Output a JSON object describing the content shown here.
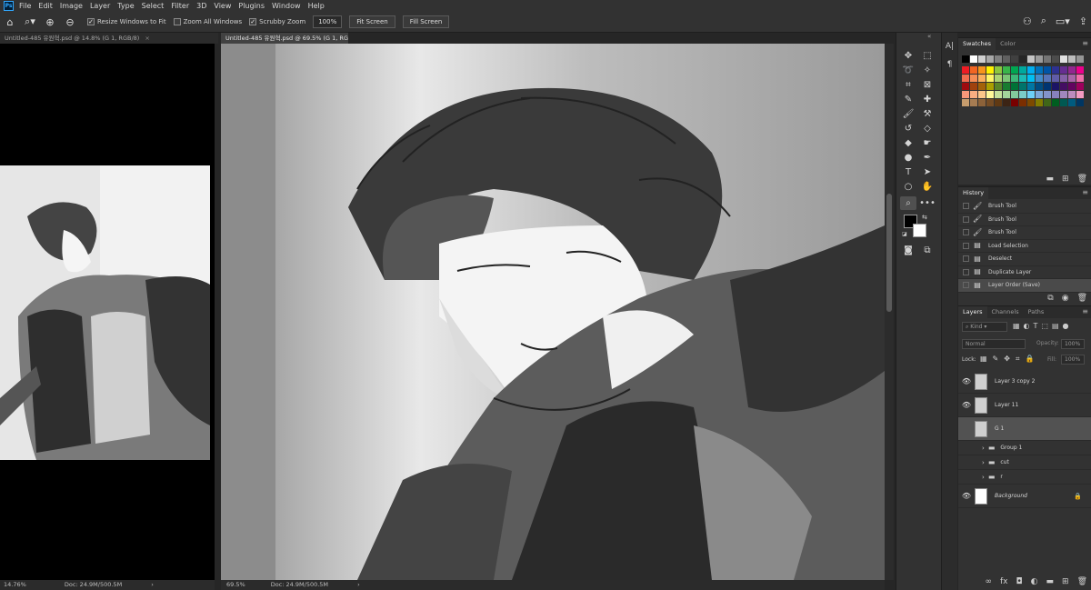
{
  "app": {
    "logo": "Ps"
  },
  "menu": [
    "File",
    "Edit",
    "Image",
    "Layer",
    "Type",
    "Select",
    "Filter",
    "3D",
    "View",
    "Plugins",
    "Window",
    "Help"
  ],
  "options": {
    "resize_windows_to_fit": "Resize Windows to Fit",
    "zoom_all_windows": "Zoom All Windows",
    "scrubby_zoom": "Scrubby Zoom",
    "zoom_value": "100%",
    "fit_screen": "Fit Screen",
    "fill_screen": "Fill Screen"
  },
  "tabs": [
    {
      "label": "Untitled-485 유원혁.psd @ 14.8% (G 1, RGB/8)",
      "close": "×"
    },
    {
      "label": "Untitled-485 유원혁.psd @ 69.5% (G 1, RGB/8)",
      "close": "×"
    }
  ],
  "status_left": {
    "zoom": "14.76%",
    "doc": "Doc: 24.9M/500.5M",
    "arrow": "›"
  },
  "status_main": {
    "zoom": "69.5%",
    "doc": "Doc: 24.9M/500.5M",
    "arrow": "›"
  },
  "swatches": {
    "tabs": [
      "Swatches",
      "Color"
    ],
    "colors": [
      [
        "#000000",
        "#ffffff",
        "#d0d0d0",
        "#a8a8a8",
        "#808080",
        "#606060",
        "#404040",
        "#262626",
        "#c4c4c4",
        "#9c9c9c",
        "#747474",
        "#4c4c4c",
        "#e0e0e0",
        "#bcbcbc",
        "#969696"
      ],
      [
        "#ed1c24",
        "#f26522",
        "#f7941d",
        "#fff200",
        "#8dc63f",
        "#39b54a",
        "#00a651",
        "#00a99d",
        "#00aeef",
        "#0072bc",
        "#0054a6",
        "#2e3192",
        "#662d91",
        "#92278f",
        "#ec008c"
      ],
      [
        "#f26c4f",
        "#f68e56",
        "#fbaf5d",
        "#fff568",
        "#acd373",
        "#7cc576",
        "#3bb878",
        "#1abbb4",
        "#00bff3",
        "#448ccb",
        "#5674b9",
        "#605ca8",
        "#8560a8",
        "#a864a8",
        "#f06eaa"
      ],
      [
        "#9e0b0f",
        "#a0410d",
        "#a36209",
        "#aba000",
        "#598527",
        "#197b30",
        "#007236",
        "#00746b",
        "#0076a3",
        "#004b80",
        "#003471",
        "#1b1464",
        "#440e62",
        "#630460",
        "#9e005d"
      ],
      [
        "#f7977a",
        "#f9ad81",
        "#fdc68a",
        "#fff799",
        "#c4df9b",
        "#a3d39c",
        "#82ca9d",
        "#7accc8",
        "#6dcff6",
        "#7da7d9",
        "#8393ca",
        "#8781bd",
        "#a187be",
        "#bd8cbf",
        "#f49ac1"
      ],
      [
        "#c69c6d",
        "#a67c52",
        "#8c6239",
        "#754c24",
        "#603913",
        "#3c2415",
        "#790000",
        "#7b2e00",
        "#7d4900",
        "#827b00",
        "#406618",
        "#005e20",
        "#005952",
        "#005b7f",
        "#003663"
      ]
    ]
  },
  "history": {
    "title": "History",
    "items": [
      "Brush Tool",
      "Brush Tool",
      "Brush Tool",
      "Load Selection",
      "Deselect",
      "Duplicate Layer",
      "Layer Order (Save)"
    ]
  },
  "layers": {
    "tabs": [
      "Layers",
      "Channels",
      "Paths"
    ],
    "filter": "Kind",
    "blend": "Normal",
    "opacity_label": "Opacity:",
    "opacity_value": "100%",
    "lock_label": "Lock:",
    "fill_label": "Fill:",
    "fill_value": "100%",
    "items": [
      {
        "name": "Layer 3 copy 2",
        "visible": true,
        "kind": "layer"
      },
      {
        "name": "Layer 11",
        "visible": true,
        "kind": "layer"
      },
      {
        "name": "G 1",
        "visible": false,
        "kind": "layer",
        "selected": true
      },
      {
        "name": "Group 1",
        "visible": false,
        "kind": "group"
      },
      {
        "name": "cut",
        "visible": false,
        "kind": "group"
      },
      {
        "name": "r",
        "visible": false,
        "kind": "group"
      },
      {
        "name": "Background",
        "visible": true,
        "kind": "background"
      }
    ]
  }
}
